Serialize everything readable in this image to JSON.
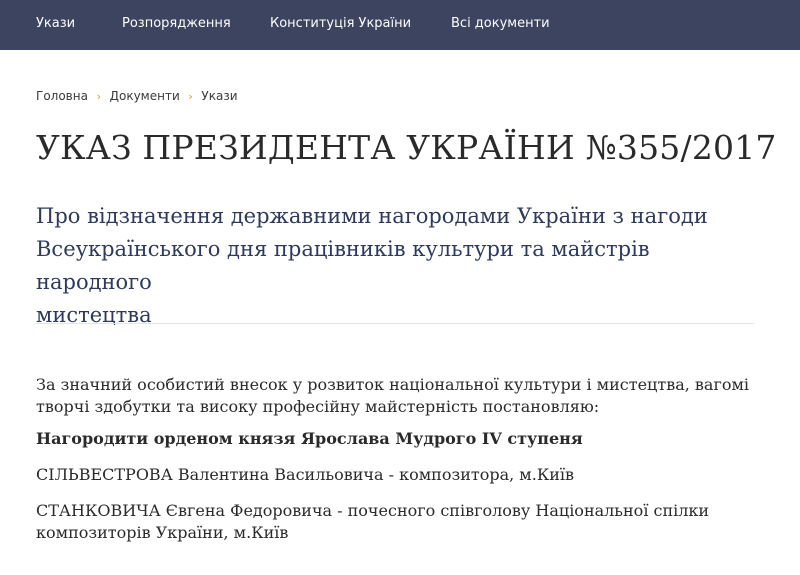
{
  "nav": {
    "items": [
      {
        "label": "Укази"
      },
      {
        "label": "Розпорядження"
      },
      {
        "label": "Конституція України"
      },
      {
        "label": "Всі документи"
      }
    ]
  },
  "breadcrumb": {
    "items": [
      {
        "label": "Головна"
      },
      {
        "label": "Документи"
      },
      {
        "label": "Укази"
      }
    ],
    "separator": "›",
    "separator_color": "#d39a2a"
  },
  "page": {
    "title": "УКАЗ ПРЕЗИДЕНТА УКРАЇНИ №355/2017",
    "subtitle_lines": [
      "Про відзначення державними нагородами України з нагоди",
      "Всеукраїнського дня працівників культури та майстрів народного",
      "мистецтва"
    ]
  },
  "body": {
    "intro_lines": [
      "За значний особистий внесок у розвиток національної культури і мистецтва, вагомі",
      "творчі здобутки та високу професійну майстерність постановляю:"
    ],
    "award_heading": "Нагородити орденом князя Ярослава Мудрого IV ступеня",
    "persons": [
      {
        "lines": [
          "СІЛЬВЕСТРОВА Валентина Васильовича - композитора, м.Київ"
        ]
      },
      {
        "lines": [
          "СТАНКОВИЧА Євгена Федоровича - почесного співголову Національної спілки",
          "композиторів України, м.Київ"
        ]
      }
    ]
  },
  "colors": {
    "nav_background": "#3c4460",
    "subtitle": "#2e3a5c"
  }
}
